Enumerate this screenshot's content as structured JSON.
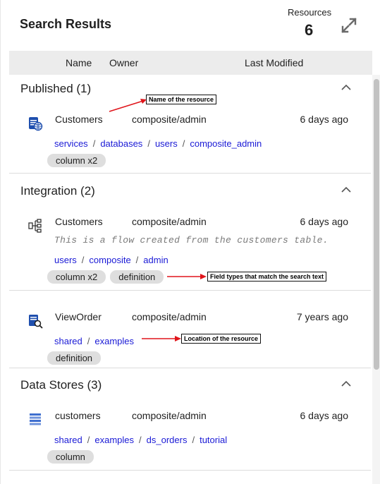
{
  "header": {
    "title": "Search Results",
    "resources_label": "Resources",
    "resources_count": "6"
  },
  "columns": {
    "name": "Name",
    "owner": "Owner",
    "last_modified": "Last Modified"
  },
  "sections": [
    {
      "title": "Published (1)",
      "items": [
        {
          "name": "Customers",
          "owner": "composite/admin",
          "modified": "6 days ago",
          "icon": "database-globe-icon",
          "path": [
            "services",
            "databases",
            "users",
            "composite_admin"
          ],
          "tags": [
            "column x2"
          ]
        }
      ]
    },
    {
      "title": "Integration (2)",
      "items": [
        {
          "name": "Customers",
          "owner": "composite/admin",
          "modified": "6 days ago",
          "icon": "flow-icon",
          "description": "This is a flow created from the customers table.",
          "path": [
            "users",
            "composite",
            "admin"
          ],
          "tags": [
            "column x2",
            "definition"
          ]
        },
        {
          "name": "ViewOrder",
          "owner": "composite/admin",
          "modified": "7 years ago",
          "icon": "view-search-icon",
          "path": [
            "shared",
            "examples"
          ],
          "tags": [
            "definition"
          ]
        }
      ]
    },
    {
      "title": "Data Stores (3)",
      "items": [
        {
          "name": "customers",
          "owner": "composite/admin",
          "modified": "6 days ago",
          "icon": "data-store-icon",
          "path": [
            "shared",
            "examples",
            "ds_orders",
            "tutorial"
          ],
          "tags": [
            "column"
          ]
        }
      ]
    }
  ],
  "callouts": {
    "name": "Name of the resource",
    "fields": "Field types that match the search text",
    "location": "Location of the resource"
  },
  "colors": {
    "link": "#1a1ad6",
    "tag_bg": "#dedede",
    "header_bg": "#ececec",
    "arrow": "#e0151b",
    "icon_blue": "#1f4fae"
  }
}
